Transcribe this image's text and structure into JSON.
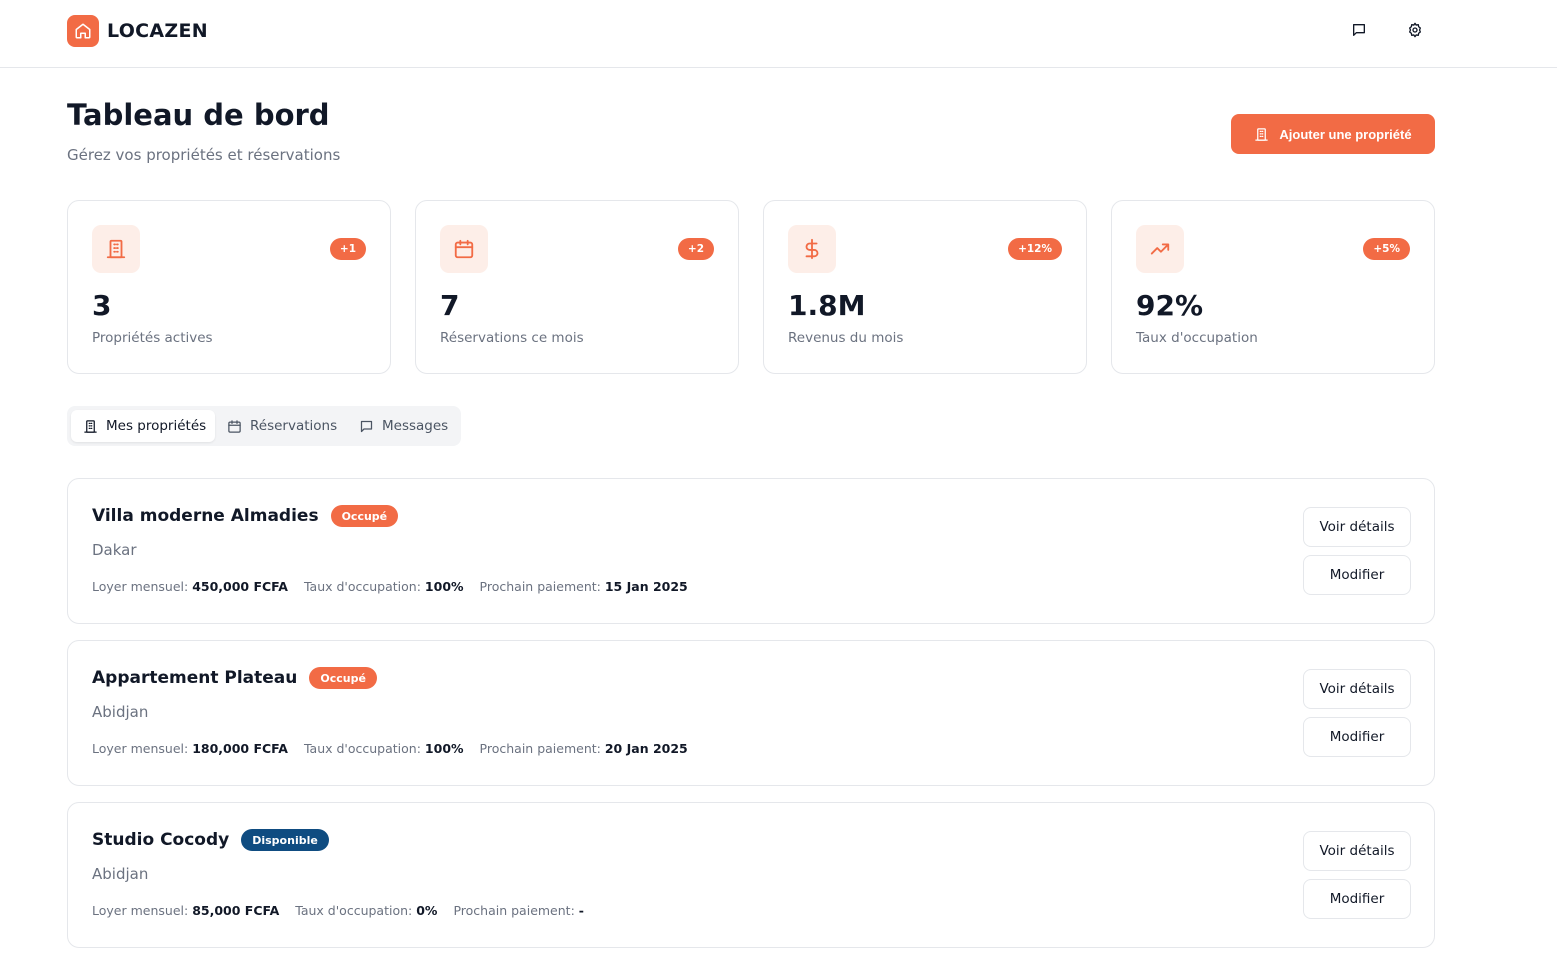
{
  "header": {
    "app_name": "LOCAZEN",
    "logo_icon": "home-icon",
    "actions": [
      {
        "icon": "message-icon"
      },
      {
        "icon": "gear-icon"
      }
    ]
  },
  "page": {
    "title": "Tableau de bord",
    "subtitle": "Gérez vos propriétés et réservations",
    "add_button": "Ajouter une propriété"
  },
  "stats": [
    {
      "icon": "building-icon",
      "badge": "+1",
      "value": "3",
      "label": "Propriétés actives"
    },
    {
      "icon": "calendar-icon",
      "badge": "+2",
      "value": "7",
      "label": "Réservations ce mois"
    },
    {
      "icon": "dollar-icon",
      "badge": "+12%",
      "value": "1.8M",
      "label": "Revenus du mois"
    },
    {
      "icon": "trending-up-icon",
      "badge": "+5%",
      "value": "92%",
      "label": "Taux d'occupation"
    }
  ],
  "tabs": [
    {
      "label": "Mes propriétés",
      "icon": "building-icon",
      "active": true
    },
    {
      "label": "Réservations",
      "icon": "calendar-icon",
      "active": false
    },
    {
      "label": "Messages",
      "icon": "message-icon",
      "active": false
    }
  ],
  "labels": {
    "rent": "Loyer mensuel:",
    "occupancy": "Taux d'occupation:",
    "next_payment": "Prochain paiement:",
    "details_button": "Voir détails",
    "edit_button": "Modifier"
  },
  "properties": [
    {
      "name": "Villa moderne Almadies",
      "status": "Occupé",
      "city": "Dakar",
      "rent": "450,000 FCFA",
      "occupancy": "100%",
      "next_payment": "15 Jan 2025"
    },
    {
      "name": "Appartement Plateau",
      "status": "Occupé",
      "city": "Abidjan",
      "rent": "180,000 FCFA",
      "occupancy": "100%",
      "next_payment": "20 Jan 2025"
    },
    {
      "name": "Studio Cocody",
      "status": "Disponible",
      "city": "Abidjan",
      "rent": "85,000 FCFA",
      "occupancy": "0%",
      "next_payment": "-"
    }
  ],
  "colors": {
    "accent": "#f26b45",
    "accent_light": "#fdeee8",
    "available": "#0f4c81",
    "muted_text": "#6b7280",
    "border": "#e5e7eb"
  }
}
